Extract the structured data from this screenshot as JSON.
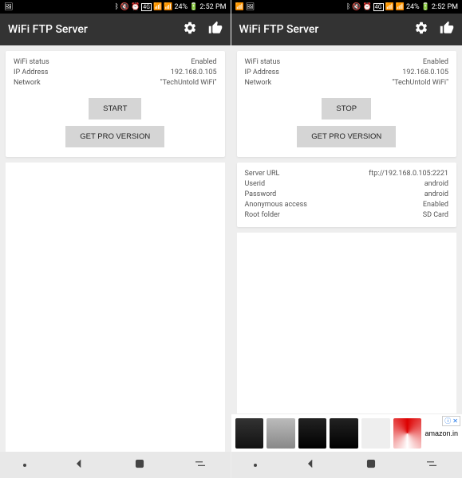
{
  "left": {
    "status": {
      "time": "2:52 PM",
      "battery": "24%",
      "notif_icon": "gallery"
    },
    "app": {
      "title": "WiFi FTP Server"
    },
    "info": {
      "wifi_status_label": "WiFi status",
      "wifi_status_value": "Enabled",
      "ip_label": "IP Address",
      "ip_value": "192.168.0.105",
      "network_label": "Network",
      "network_value": "\"TechUntold WiFi\""
    },
    "buttons": {
      "primary": "START",
      "pro": "GET PRO VERSION"
    }
  },
  "right": {
    "status": {
      "time": "2:52 PM",
      "battery": "24%",
      "notif_icon": "gallery"
    },
    "app": {
      "title": "WiFi FTP Server"
    },
    "info": {
      "wifi_status_label": "WiFi status",
      "wifi_status_value": "Enabled",
      "ip_label": "IP Address",
      "ip_value": "192.168.0.105",
      "network_label": "Network",
      "network_value": "\"TechUntold WiFi\""
    },
    "buttons": {
      "primary": "STOP",
      "pro": "GET PRO VERSION"
    },
    "server": {
      "url_label": "Server URL",
      "url_value": "ftp://192.168.0.105:2221",
      "user_label": "Userid",
      "user_value": "android",
      "pass_label": "Password",
      "pass_value": "android",
      "anon_label": "Anonymous access",
      "anon_value": "Enabled",
      "root_label": "Root folder",
      "root_value": "SD Card"
    },
    "ad": {
      "brand": "amazon.in"
    }
  }
}
